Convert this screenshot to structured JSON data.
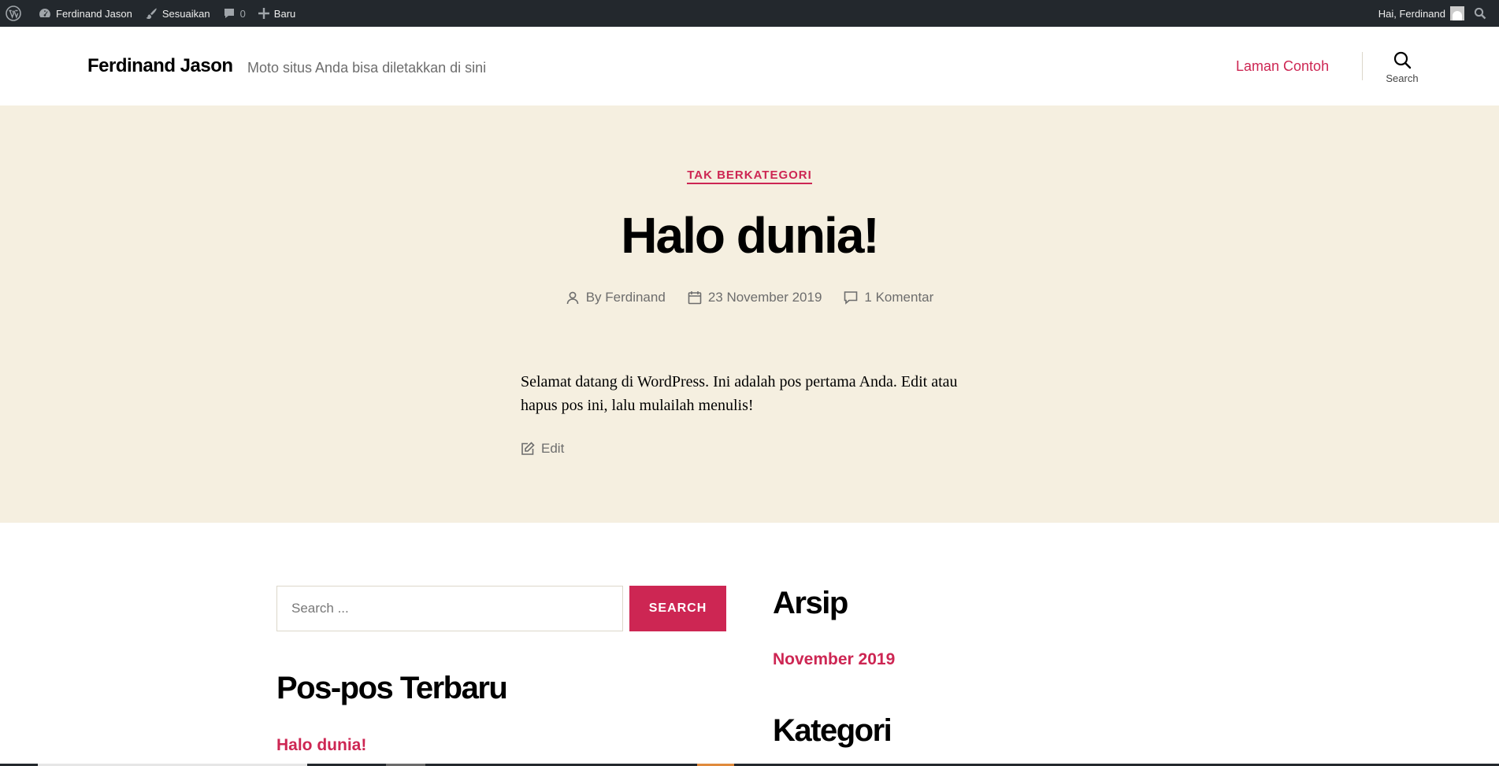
{
  "adminbar": {
    "site_name": "Ferdinand Jason",
    "customize": "Sesuaikan",
    "comments_count": "0",
    "new_label": "Baru",
    "greeting": "Hai, Ferdinand"
  },
  "header": {
    "site_title": "Ferdinand Jason",
    "tagline": "Moto situs Anda bisa diletakkan di sini",
    "nav_link": "Laman Contoh",
    "search_label": "Search"
  },
  "post": {
    "category": "TAK BERKATEGORI",
    "title": "Halo dunia!",
    "author": "By Ferdinand",
    "date": "23 November 2019",
    "comments": "1 Komentar",
    "content": "Selamat datang di WordPress. Ini adalah pos pertama Anda. Edit atau hapus pos ini, lalu mulailah menulis!",
    "edit_label": "Edit"
  },
  "widgets": {
    "search_placeholder": "Search ...",
    "search_button": "SEARCH",
    "recent_posts_title": "Pos-pos Terbaru",
    "recent_posts": [
      "Halo dunia!"
    ],
    "archives_title": "Arsip",
    "archives": [
      "November 2019"
    ],
    "categories_title": "Kategori"
  },
  "colors": {
    "accent": "#cd2653",
    "hero_bg": "#f5efe0",
    "adminbar_bg": "#23282d"
  }
}
